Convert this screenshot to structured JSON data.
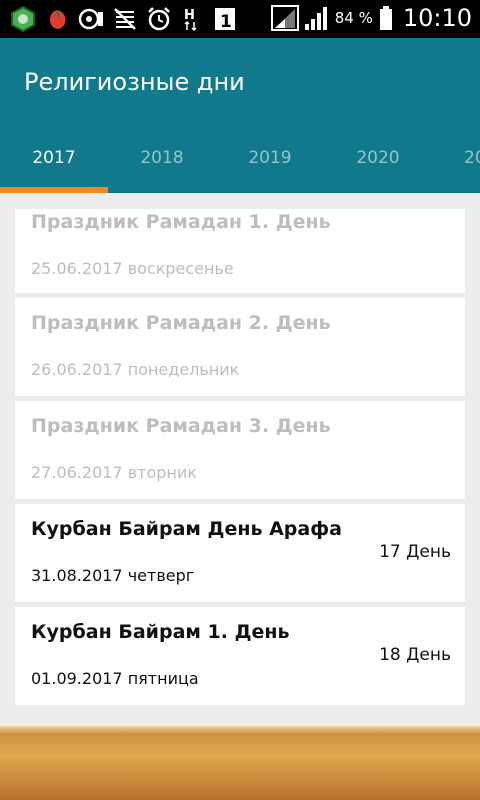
{
  "status_bar": {
    "battery_percent": "84 %",
    "time": "10:10",
    "icons": [
      "app-badge-icon",
      "flower-icon",
      "image-icon",
      "mute-icon",
      "alarm-icon",
      "network-h-icon",
      "sim-1-icon",
      "signal-icon",
      "signal-icon",
      "battery-icon"
    ]
  },
  "app_bar": {
    "title": "Религиозные дни",
    "tabs": [
      {
        "label": "2017"
      },
      {
        "label": "2018"
      },
      {
        "label": "2019"
      },
      {
        "label": "2020"
      },
      {
        "label": "20"
      }
    ],
    "active_tab": "2017"
  },
  "events": [
    {
      "title": "Праздник Рамадан 1. День",
      "date": "25.06.2017 воскресенье",
      "count": "",
      "past": true
    },
    {
      "title": "Праздник Рамадан 2. День",
      "date": "26.06.2017 понедельник",
      "count": "",
      "past": true
    },
    {
      "title": "Праздник Рамадан 3. День",
      "date": "27.06.2017 вторник",
      "count": "",
      "past": true
    },
    {
      "title": "Курбан Байрам День Арафа",
      "date": "31.08.2017 четверг",
      "count": "17 День",
      "past": false
    },
    {
      "title": "Курбан Байрам 1. День",
      "date": "01.09.2017 пятница",
      "count": "18 День",
      "past": false
    }
  ],
  "colors": {
    "app_bar": "#107a8c",
    "tab_indicator": "#f28a1e",
    "past_text": "#bdbdbd"
  }
}
